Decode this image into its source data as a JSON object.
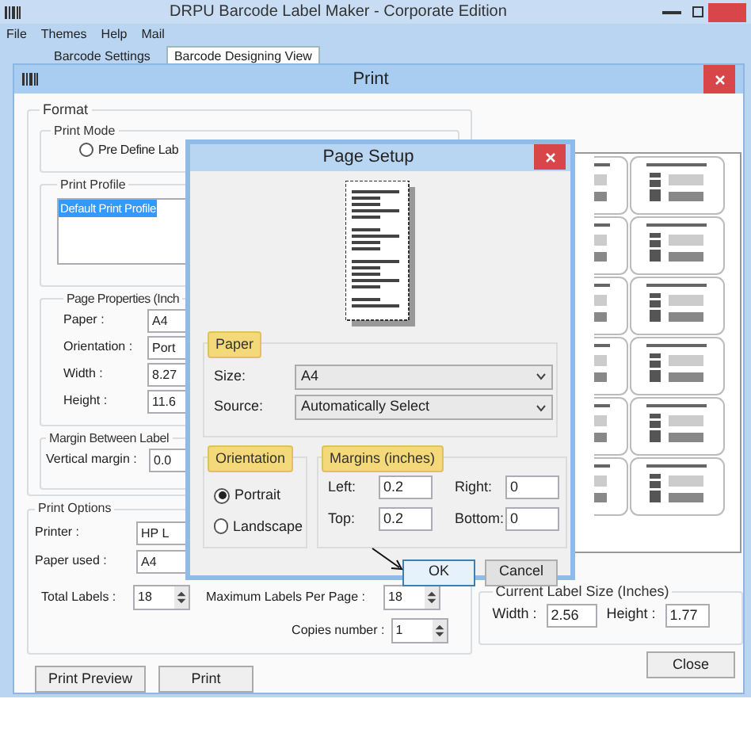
{
  "window": {
    "title": "DRPU Barcode Label Maker - Corporate Edition"
  },
  "menu": [
    "File",
    "Themes",
    "Help",
    "Mail"
  ],
  "tabs": [
    {
      "label": "Barcode Settings",
      "selected": false
    },
    {
      "label": "Barcode Designing View",
      "selected": true
    }
  ],
  "print_dialog": {
    "title": "Print",
    "format_label": "Format",
    "print_mode": {
      "label": "Print Mode",
      "option": "Pre Define Lab",
      "selected": false
    },
    "print_profile": {
      "label": "Print Profile",
      "items": [
        {
          "label": "Default Print Profile",
          "selected": true
        }
      ]
    },
    "page_properties": {
      "label": "Page Properties (Inch",
      "fields": [
        {
          "label": "Paper :",
          "value": "A4"
        },
        {
          "label": "Orientation :",
          "value": "Port"
        },
        {
          "label": "Width :",
          "value": "8.27"
        },
        {
          "label": "Height :",
          "value": "11.6"
        }
      ]
    },
    "margin": {
      "label": "Margin Between Label",
      "fields": [
        {
          "label": "Vertical margin :",
          "value": "0.0"
        }
      ]
    },
    "print_options": {
      "label": "Print Options",
      "printer": {
        "label": "Printer :",
        "value": "HP L"
      },
      "paper_used": {
        "label": "Paper used :",
        "value": "A4"
      },
      "total_labels": {
        "label": "Total Labels :",
        "value": "18"
      },
      "max_labels": {
        "label": "Maximum Labels Per Page :",
        "value": "18"
      },
      "copies": {
        "label": "Copies number :",
        "value": "1"
      }
    },
    "label_size": {
      "label": "Current Label Size (Inches)",
      "width": {
        "label": "Width :",
        "value": "2.56"
      },
      "height": {
        "label": "Height :",
        "value": "1.77"
      }
    },
    "buttons": [
      "Print Preview",
      "Print",
      "Close"
    ]
  },
  "page_setup": {
    "title": "Page Setup",
    "paper": {
      "label": "Paper",
      "size": {
        "label": "Size:",
        "value": "A4"
      },
      "source": {
        "label": "Source:",
        "value": "Automatically Select"
      }
    },
    "orientation": {
      "label": "Orientation",
      "options": [
        {
          "label": "Portrait",
          "selected": true
        },
        {
          "label": "Landscape",
          "selected": false
        }
      ]
    },
    "margins": {
      "label": "Margins (inches)",
      "fields": [
        {
          "label": "Left:",
          "value": "0.2"
        },
        {
          "label": "Right:",
          "value": "0"
        },
        {
          "label": "Top:",
          "value": "0.2"
        },
        {
          "label": "Bottom:",
          "value": "0"
        }
      ]
    },
    "buttons": [
      {
        "label": "OK",
        "focused": true
      },
      {
        "label": "Cancel",
        "focused": false
      }
    ]
  }
}
